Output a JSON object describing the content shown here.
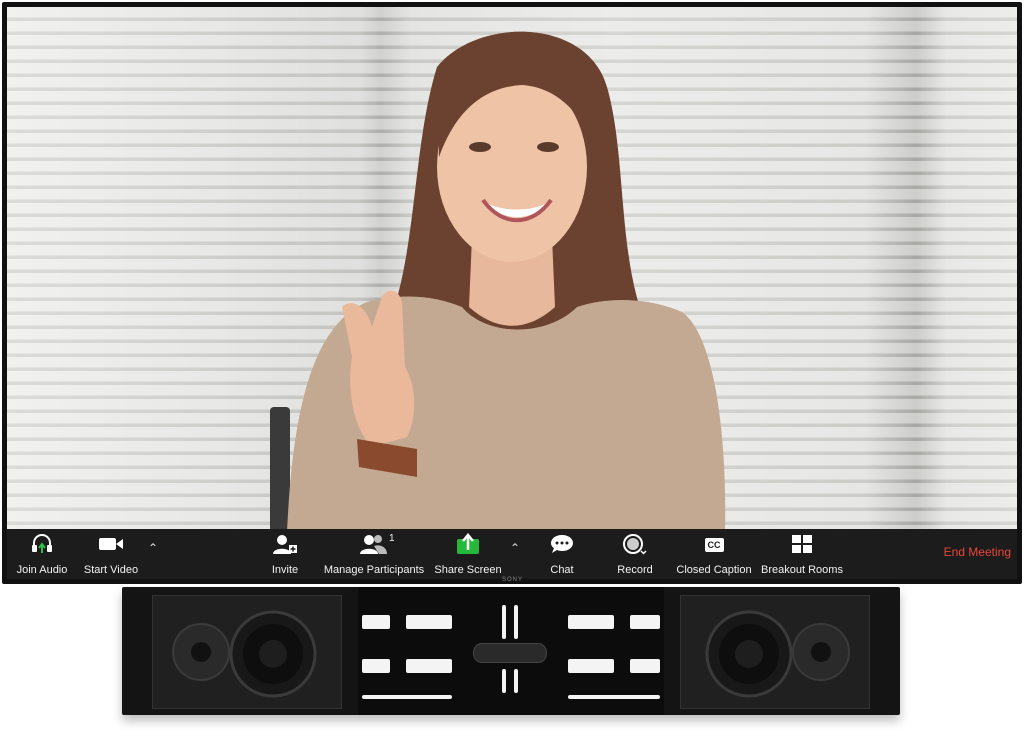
{
  "toolbar": {
    "items": [
      {
        "label": "Join Audio",
        "icon": "headphones-icon"
      },
      {
        "label": "Start Video",
        "icon": "video-camera-icon"
      },
      {
        "label": "Invite",
        "icon": "add-user-icon"
      },
      {
        "label": "Manage Participants",
        "icon": "participants-icon",
        "badge": "1"
      },
      {
        "label": "Share Screen",
        "icon": "share-screen-icon"
      },
      {
        "label": "Chat",
        "icon": "chat-bubble-icon"
      },
      {
        "label": "Record",
        "icon": "record-icon"
      },
      {
        "label": "Closed Caption",
        "icon": "closed-caption-icon",
        "glyph": "CC"
      },
      {
        "label": "Breakout Rooms",
        "icon": "breakout-rooms-icon"
      }
    ],
    "end_meeting": "End Meeting"
  },
  "device": {
    "brand": "SONY"
  },
  "colors": {
    "toolbar_bg": "#1c1c1c",
    "share_green": "#25b83a",
    "end_red": "#e8463b",
    "audio_green": "#30c04a"
  }
}
